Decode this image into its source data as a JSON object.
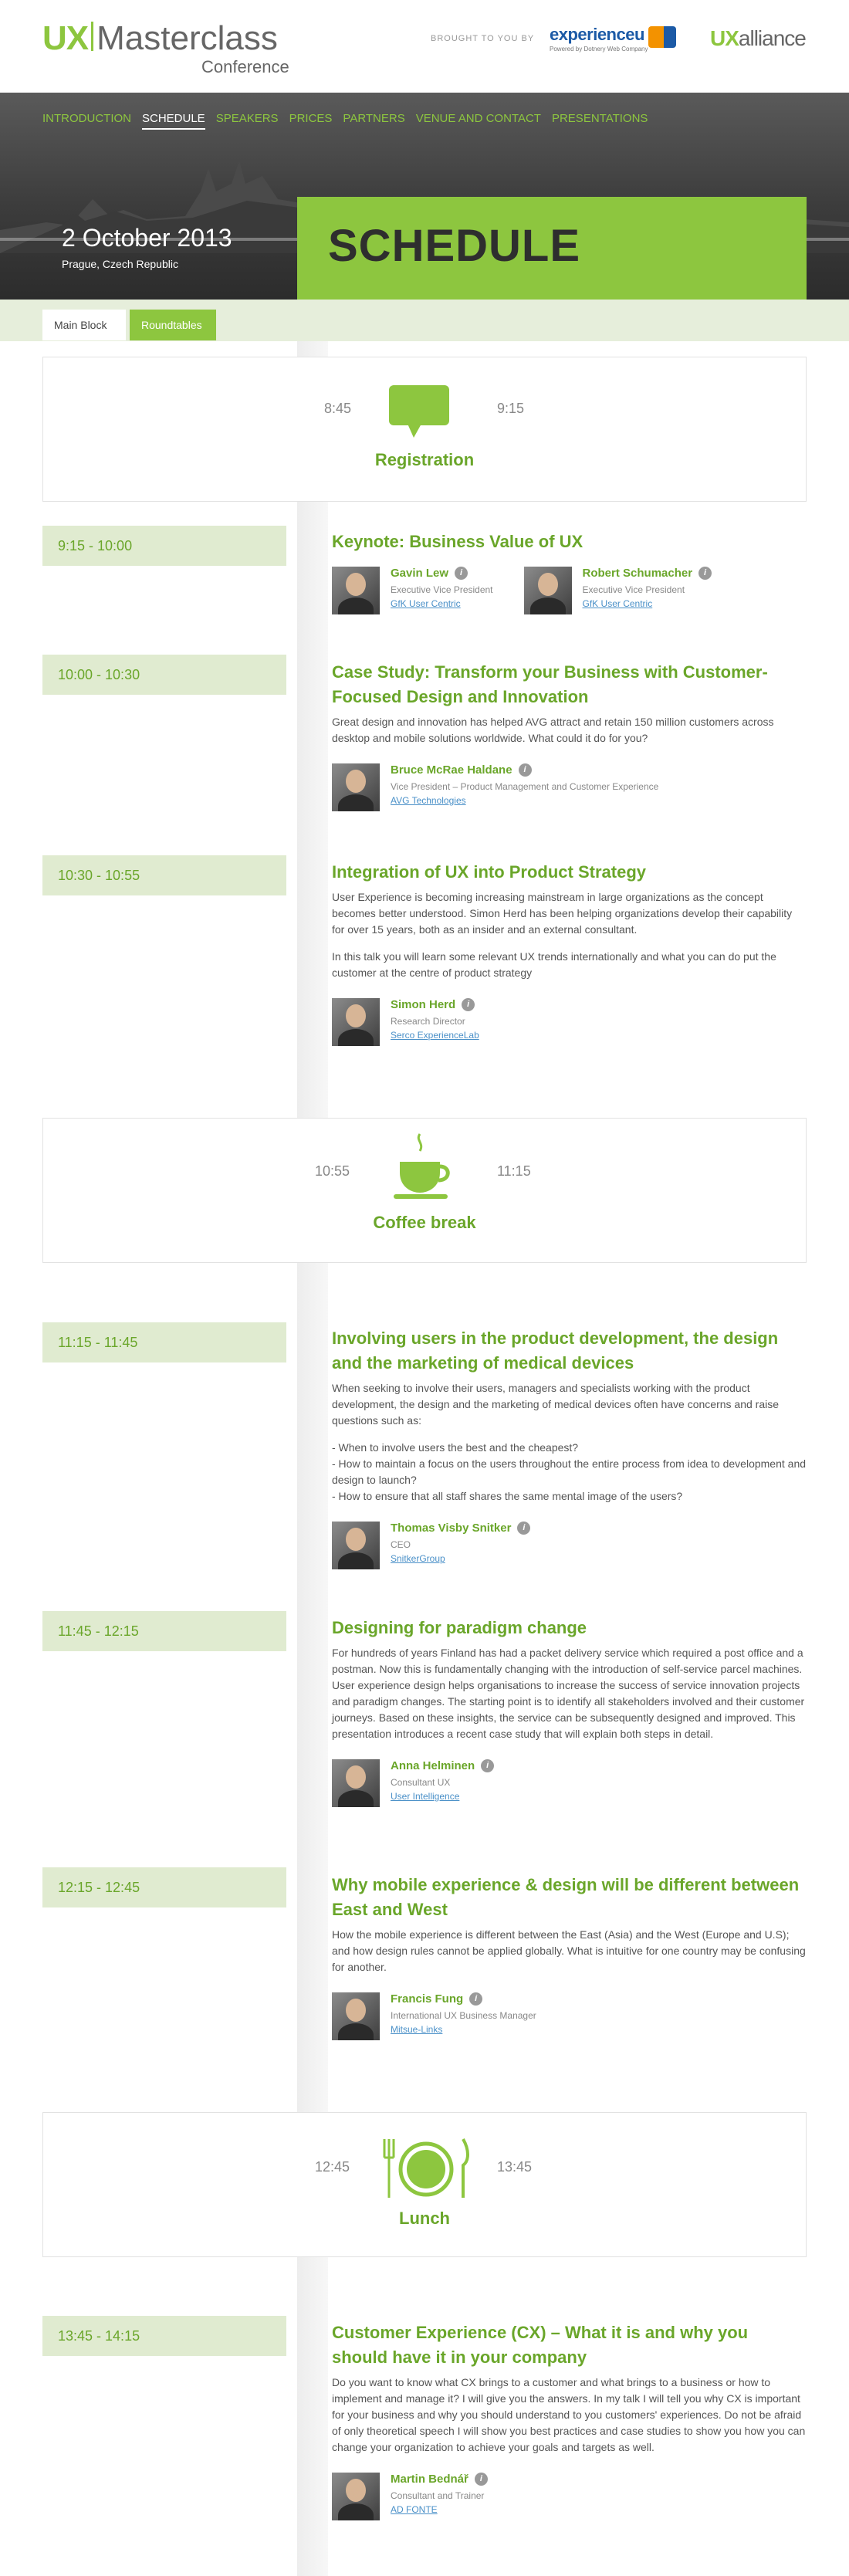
{
  "header": {
    "logo_ux": "UX",
    "logo_masterclass": "Masterclass",
    "logo_conference": "Conference",
    "brought_by": "BROUGHT TO YOU BY",
    "sponsor_name": "experienceu",
    "sponsor_sub": "Powered by Dotnery Web Company",
    "alliance_ux": "UX",
    "alliance_rest": "alliance"
  },
  "nav": [
    {
      "label": "INTRODUCTION"
    },
    {
      "label": "SCHEDULE"
    },
    {
      "label": "SPEAKERS"
    },
    {
      "label": "PRICES"
    },
    {
      "label": "PARTNERS"
    },
    {
      "label": "VENUE AND CONTACT"
    },
    {
      "label": "PRESENTATIONS"
    }
  ],
  "hero": {
    "date": "2 October 2013",
    "location": "Prague, Czech Republic",
    "title": "SCHEDULE"
  },
  "tabs": {
    "main": "Main Block",
    "round": "Roundtables"
  },
  "breaks": [
    {
      "start": "8:45",
      "end": "9:15",
      "label": "Registration",
      "icon": "speech-bubble-icon"
    },
    {
      "start": "10:55",
      "end": "11:15",
      "label": "Coffee break",
      "icon": "coffee-cup-icon"
    },
    {
      "start": "12:45",
      "end": "13:45",
      "label": "Lunch",
      "icon": "plate-cutlery-icon"
    }
  ],
  "sessions": [
    {
      "time": "9:15 - 10:00",
      "title": "Keynote: Business Value of UX",
      "desc": [],
      "speakers": [
        {
          "name": "Gavin Lew",
          "role": "Executive Vice President",
          "company": "GfK User Centric"
        },
        {
          "name": "Robert Schumacher",
          "role": "Executive Vice President",
          "company": "GfK User Centric"
        }
      ]
    },
    {
      "time": "10:00 - 10:30",
      "title": "Case Study: Transform your Business with Customer-Focused Design and Innovation",
      "desc": [
        "Great design and innovation has helped AVG attract and retain 150 million customers across desktop and mobile solutions worldwide. What could it do for you?"
      ],
      "speakers": [
        {
          "name": "Bruce McRae Haldane",
          "role": "Vice President – Product Management and Customer Experience",
          "company": "AVG Technologies"
        }
      ]
    },
    {
      "time": "10:30 - 10:55",
      "title": "Integration of UX into Product Strategy",
      "desc": [
        "User Experience is becoming increasing mainstream in large organizations as the concept becomes better understood. Simon Herd has been helping organizations develop their capability for over 15 years, both as an insider and an external consultant.",
        "In this talk you will learn some relevant UX trends internationally and what you can do put the customer at the centre of product strategy"
      ],
      "speakers": [
        {
          "name": "Simon Herd",
          "role": "Research Director",
          "company": "Serco ExperienceLab"
        }
      ]
    },
    {
      "time": "11:15 - 11:45",
      "title": "Involving users in the product development, the design and the marketing of medical devices",
      "desc": [
        "When seeking to involve their users, managers and specialists working with the product development, the design and the marketing of medical devices often have concerns and raise questions such as:",
        "- When to involve users the best and the cheapest?\n- How to maintain a focus on the users throughout the entire process from idea to development and design to launch?\n- How to ensure that all staff shares the same mental image of the users?"
      ],
      "speakers": [
        {
          "name": "Thomas Visby Snitker",
          "role": "CEO",
          "company": "SnitkerGroup"
        }
      ]
    },
    {
      "time": "11:45 - 12:15",
      "title": "Designing for paradigm change",
      "desc": [
        "For hundreds of years Finland has had a packet delivery service which required a post office and a postman. Now this is fundamentally changing with the introduction of self-service parcel machines. User experience design helps organisations to increase the success of service innovation projects and paradigm changes. The starting point is to identify all stakeholders involved and their customer journeys. Based on these insights, the service can be subsequently designed and improved. This presentation introduces a recent case study that will explain both steps in detail."
      ],
      "speakers": [
        {
          "name": "Anna Helminen",
          "role": "Consultant UX",
          "company": "User Intelligence"
        }
      ]
    },
    {
      "time": "12:15 - 12:45",
      "title": "Why mobile experience & design will be different between East and West",
      "desc": [
        "How the mobile experience is different between the East (Asia) and the West (Europe and U.S); and how design rules cannot be applied globally. What is intuitive for one country may be confusing for another."
      ],
      "speakers": [
        {
          "name": "Francis Fung",
          "role": "International UX Business Manager",
          "company": "Mitsue-Links"
        }
      ]
    },
    {
      "time": "13:45 - 14:15",
      "title": "Customer Experience (CX) – What it is and why you should have it in your company",
      "desc": [
        "Do you want to know what CX brings to a customer and what brings to a business or how to implement and manage it? I will give you the answers. In my talk I will tell you why CX is important for your business and why you should understand to you customers' experiences. Do not be afraid of only theoretical speech I will show you best practices and case studies to show you how you can change your organization to achieve your goals and targets as well."
      ],
      "speakers": [
        {
          "name": "Martin Bednář",
          "role": "Consultant and Trainer",
          "company": "AD FONTE"
        }
      ]
    }
  ],
  "colors": {
    "accent": "#8dc63f",
    "accent_dark": "#6aa62a",
    "time_bg": "#e0ebd0",
    "link": "#4a90c8"
  }
}
